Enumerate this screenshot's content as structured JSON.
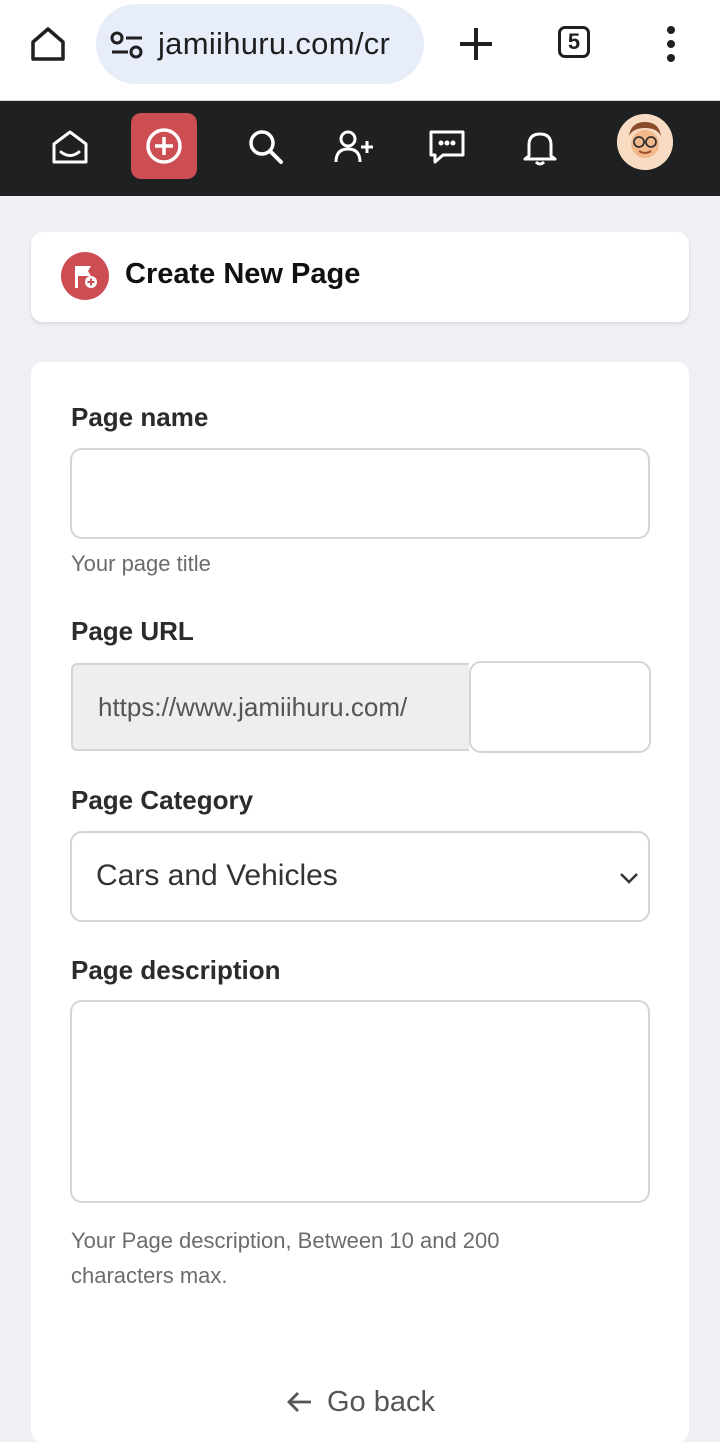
{
  "browser": {
    "url": "jamiihuru.com/cr",
    "tab_count": "5"
  },
  "nav": {
    "items": [
      "home-icon",
      "create-icon",
      "search-icon",
      "add-friend-icon",
      "messages-icon",
      "notifications-icon",
      "avatar"
    ],
    "accent": "#cc4d52"
  },
  "header": {
    "title": "Create New Page"
  },
  "form": {
    "page_name": {
      "label": "Page name",
      "value": "",
      "hint": "Your page title"
    },
    "page_url": {
      "label": "Page URL",
      "prefix": "https://www.jamiihuru.com/",
      "value": ""
    },
    "page_category": {
      "label": "Page Category",
      "selected": "Cars and Vehicles"
    },
    "page_description": {
      "label": "Page description",
      "value": "",
      "hint": "Your Page description, Between 10 and 200 characters max."
    }
  },
  "footer": {
    "back_label": "Go back"
  }
}
